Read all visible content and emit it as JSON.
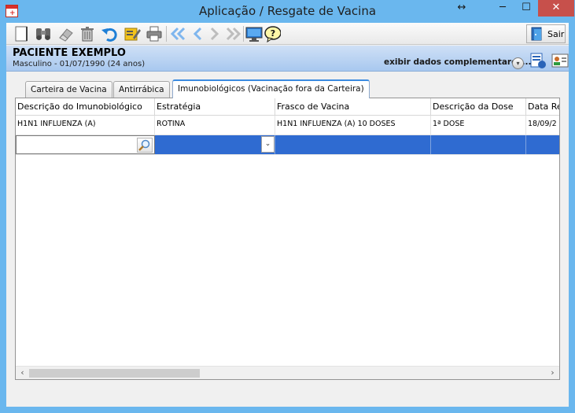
{
  "window": {
    "title": "Aplicação / Resgate de Vacina",
    "controls": {
      "restore": "↔",
      "minimize": "─",
      "maximize": "☐",
      "close": "✕"
    }
  },
  "toolbar": {
    "icons": [
      "new-document-icon",
      "binoculars-search-icon",
      "eraser-icon",
      "trash-icon",
      "undo-icon",
      "edit-note-icon",
      "printer-icon",
      "first-record-icon",
      "previous-record-icon",
      "next-record-icon",
      "last-record-icon",
      "monitor-icon",
      "help-icon"
    ],
    "exit_label": "Sair"
  },
  "patient": {
    "name": "PACIENTE EXEMPLO",
    "info": "Masculino - 01/07/1990 (24 anos)",
    "details_label": "exibir dados complementares..."
  },
  "tabs": [
    {
      "label": "Carteira de Vacina",
      "active": false
    },
    {
      "label": "Antirrábica",
      "active": false
    },
    {
      "label": "Imunobiológicos (Vacinação fora da Carteira)",
      "active": true
    }
  ],
  "grid": {
    "columns": [
      "Descrição do Imunobiológico",
      "Estratégia",
      "Frasco de Vacina",
      "Descrição da Dose",
      "Data Re"
    ],
    "rows": [
      [
        "H1N1 INFLUENZA (A)",
        "ROTINA",
        "H1N1 INFLUENZA (A) 10 DOSES",
        "1ª DOSE",
        "18/09/2"
      ]
    ],
    "edit_row": {
      "descricao": "",
      "estrategia": ""
    },
    "scroll": {
      "left": "‹",
      "right": "›"
    }
  },
  "colors": {
    "titlebar": "#6ab7ee",
    "selection": "#2f6bd1",
    "close": "#c7504b"
  }
}
